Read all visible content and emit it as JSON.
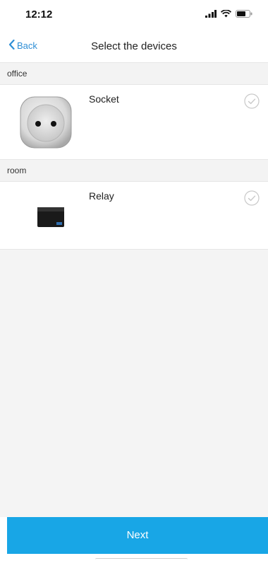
{
  "status_bar": {
    "time": "12:12",
    "icons": [
      "signal-icon",
      "wifi-icon",
      "battery-icon"
    ]
  },
  "nav": {
    "back_label": "Back",
    "title": "Select the devices"
  },
  "sections": [
    {
      "header": "office",
      "devices": [
        {
          "name": "Socket",
          "icon": "socket-image",
          "checked": false
        }
      ]
    },
    {
      "header": "room",
      "devices": [
        {
          "name": "Relay",
          "icon": "relay-image",
          "checked": false
        }
      ]
    }
  ],
  "footer": {
    "next_label": "Next"
  },
  "colors": {
    "accent": "#18a6e6",
    "back_link": "#2f8fd6",
    "section_bg": "#f3f3f3"
  }
}
